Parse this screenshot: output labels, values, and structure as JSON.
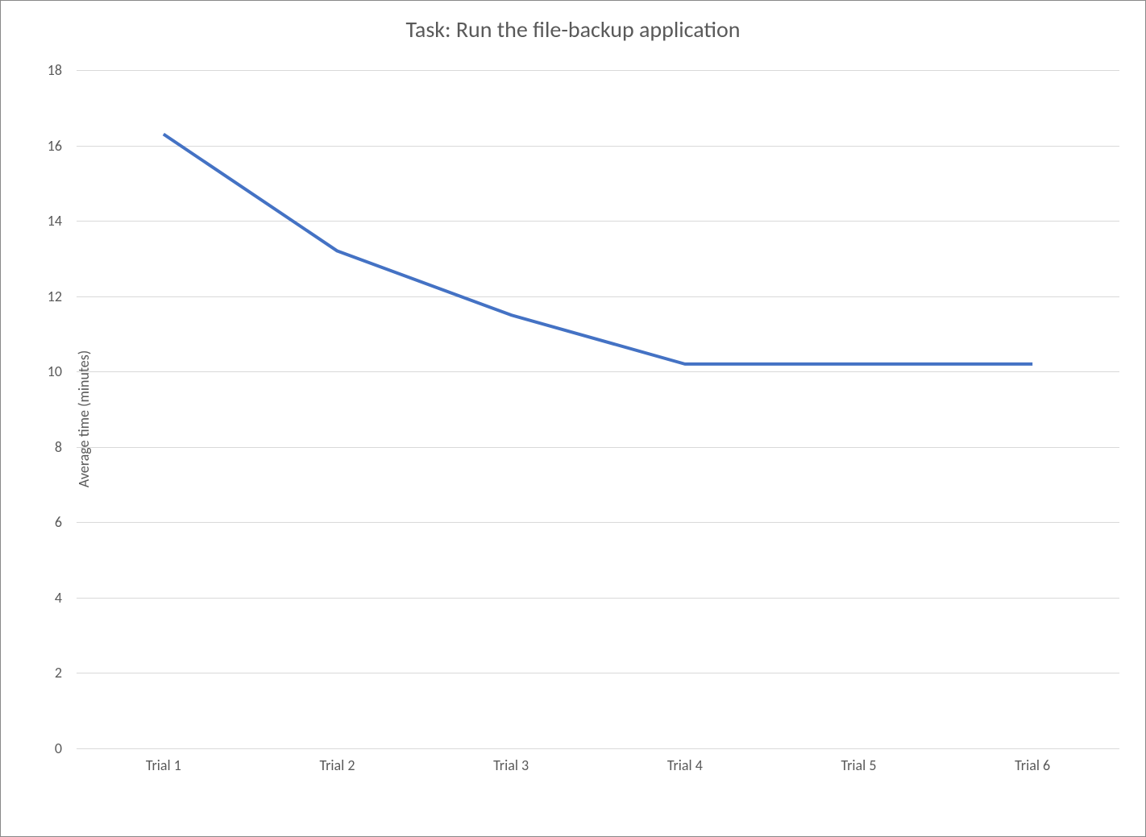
{
  "chart_data": {
    "type": "line",
    "title": "Task: Run the file-backup application",
    "ylabel": "Average time (minutes)",
    "xlabel": "",
    "categories": [
      "Trial 1",
      "Trial 2",
      "Trial 3",
      "Trial 4",
      "Trial 5",
      "Trial 6"
    ],
    "values": [
      16.3,
      13.2,
      11.5,
      10.2,
      10.2,
      10.2
    ],
    "ylim": [
      0,
      18
    ],
    "yticks": [
      0,
      2,
      4,
      6,
      8,
      10,
      12,
      14,
      16,
      18
    ],
    "grid": true,
    "line_color": "#4472c4"
  }
}
